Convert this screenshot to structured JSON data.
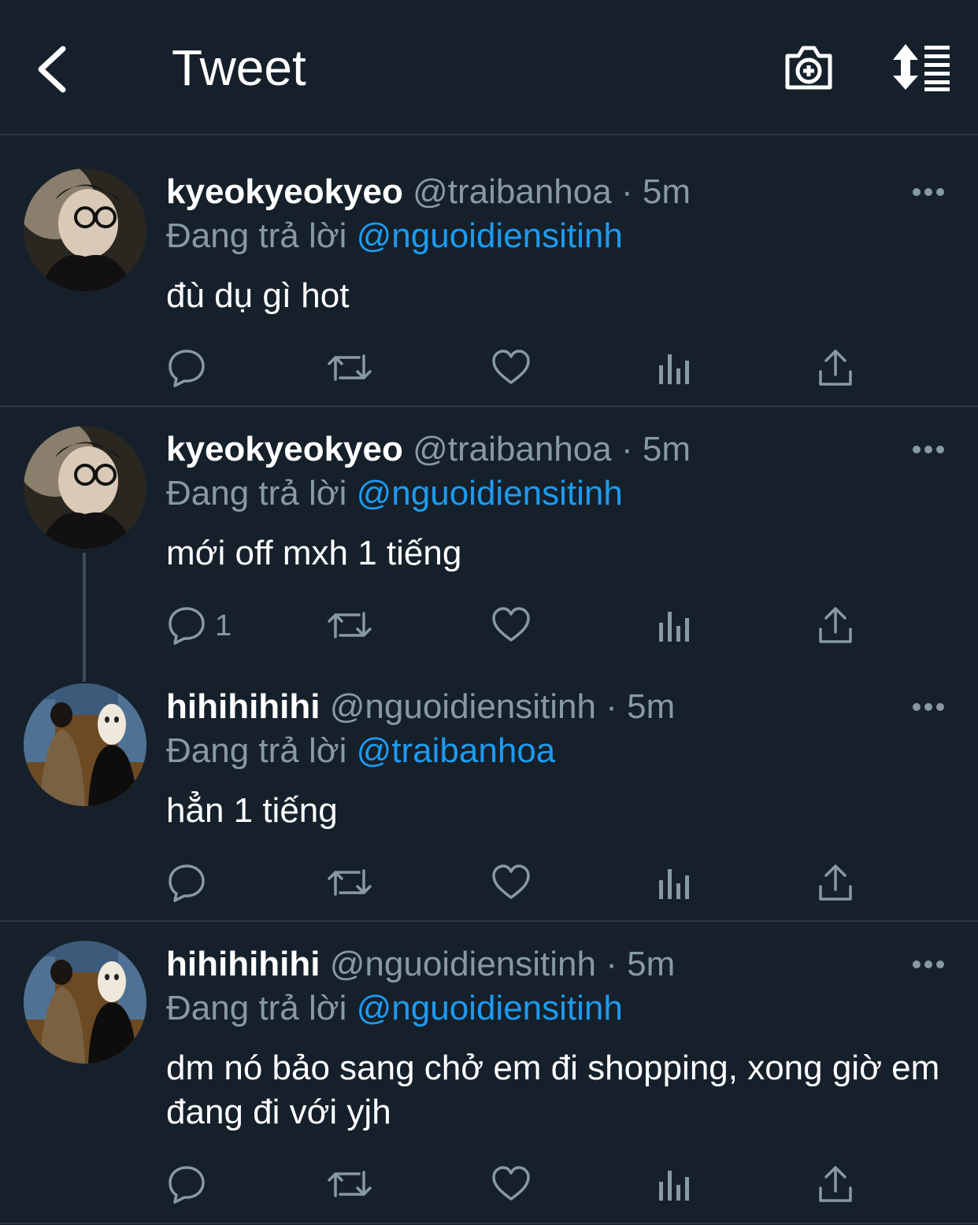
{
  "header": {
    "title": "Tweet",
    "icons": [
      "back-arrow-icon",
      "camera-add-icon",
      "sort-timeline-icon"
    ]
  },
  "tweets": [
    {
      "name": "kyeokyeokyeo",
      "handle": "@traibanhoa",
      "dot": "·",
      "time": "5m",
      "reply_prefix": "Đang trả lời",
      "reply_to": "@nguoidiensitinh",
      "text": "đù dụ gì hot",
      "reply_count": ""
    },
    {
      "name": "kyeokyeokyeo",
      "handle": "@traibanhoa",
      "dot": "·",
      "time": "5m",
      "reply_prefix": "Đang trả lời",
      "reply_to": "@nguoidiensitinh",
      "text": "mới off mxh 1 tiếng",
      "reply_count": "1"
    },
    {
      "name": "hihihihihi",
      "handle": "@nguoidiensitinh",
      "dot": "·",
      "time": "5m",
      "reply_prefix": "Đang trả lời",
      "reply_to": "@traibanhoa",
      "text": "hẳn 1 tiếng",
      "reply_count": ""
    },
    {
      "name": "hihihihihi",
      "handle": "@nguoidiensitinh",
      "dot": "·",
      "time": "5m",
      "reply_prefix": "Đang trả lời",
      "reply_to": "@nguoidiensitinh",
      "text": "dm nó bảo sang chở em đi shopping, xong giờ em đang đi với yjh",
      "reply_count": ""
    }
  ],
  "colors": {
    "background": "#15202b",
    "muted": "#8899a6",
    "link": "#1d9bf0",
    "divider": "#2b3640"
  }
}
